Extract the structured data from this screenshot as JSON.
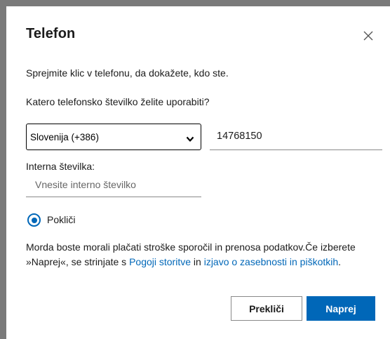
{
  "dialog": {
    "title": "Telefon",
    "instruction": "Sprejmite klic v telefonu, da dokažete, kdo ste.",
    "question": "Katero telefonsko številko želite uporabiti?",
    "country_select": {
      "selected": "Slovenija (+386)"
    },
    "phone_number": {
      "value": "14768150"
    },
    "extension": {
      "label": "Interna številka:",
      "placeholder": "Vnesite interno številko"
    },
    "method": {
      "label": "Pokliči",
      "selected": true
    },
    "disclaimer": {
      "text_before": "Morda boste morali plačati stroške sporočil in prenosa podatkov.Če izberete »Naprej«, se strinjate s ",
      "terms_link": "Pogoji storitve",
      "text_middle": " in ",
      "privacy_link": "izjavo o zasebnosti in piškotkih",
      "text_after": "."
    },
    "buttons": {
      "cancel": "Prekliči",
      "next": "Naprej"
    }
  },
  "colors": {
    "accent": "#0067b8",
    "backdrop": "#7a7a7a"
  },
  "icons": {
    "close": "close-icon",
    "dropdown": "chevron-down-icon"
  }
}
